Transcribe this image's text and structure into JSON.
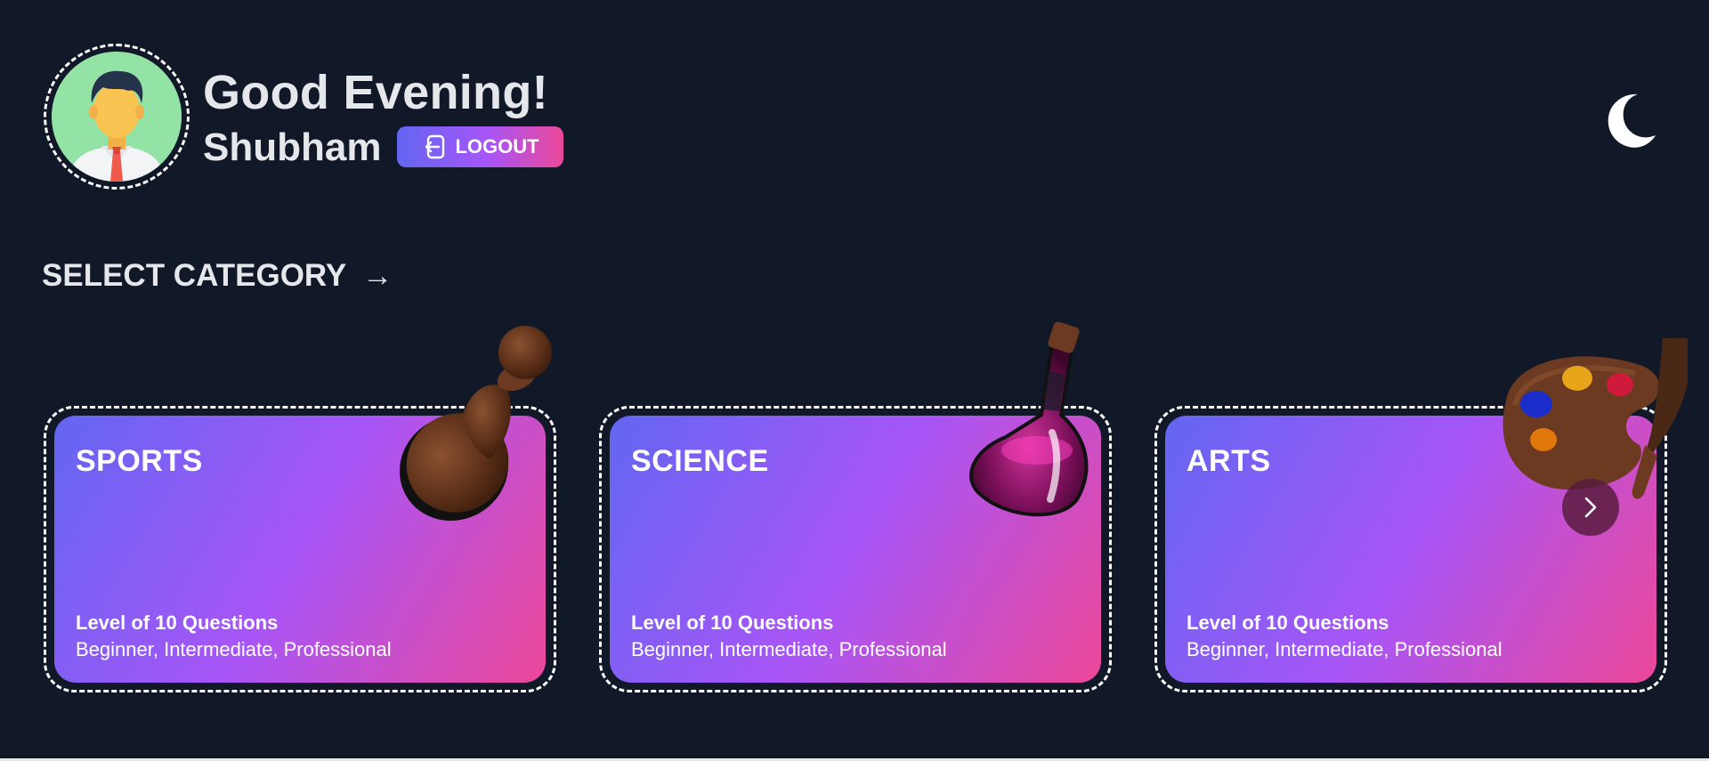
{
  "header": {
    "greeting": "Good Evening!",
    "username": "Shubham",
    "logout_label": "LOGOUT"
  },
  "section": {
    "title": "SELECT CATEGORY",
    "arrow": "→"
  },
  "categories": [
    {
      "title": "SPORTS",
      "level": "Level of 10 Questions",
      "levels": "Beginner, Intermediate, Professional",
      "icon": "chess-pawn-icon"
    },
    {
      "title": "SCIENCE",
      "level": "Level of 10 Questions",
      "levels": "Beginner, Intermediate, Professional",
      "icon": "flask-icon"
    },
    {
      "title": "ARTS",
      "level": "Level of 10 Questions",
      "levels": "Beginner, Intermediate, Professional",
      "icon": "paint-palette-icon"
    }
  ],
  "colors": {
    "background": "#111827",
    "gradient_start": "#6366f1",
    "gradient_mid": "#a855f7",
    "gradient_end": "#ec4899",
    "text": "#e5e7eb"
  }
}
